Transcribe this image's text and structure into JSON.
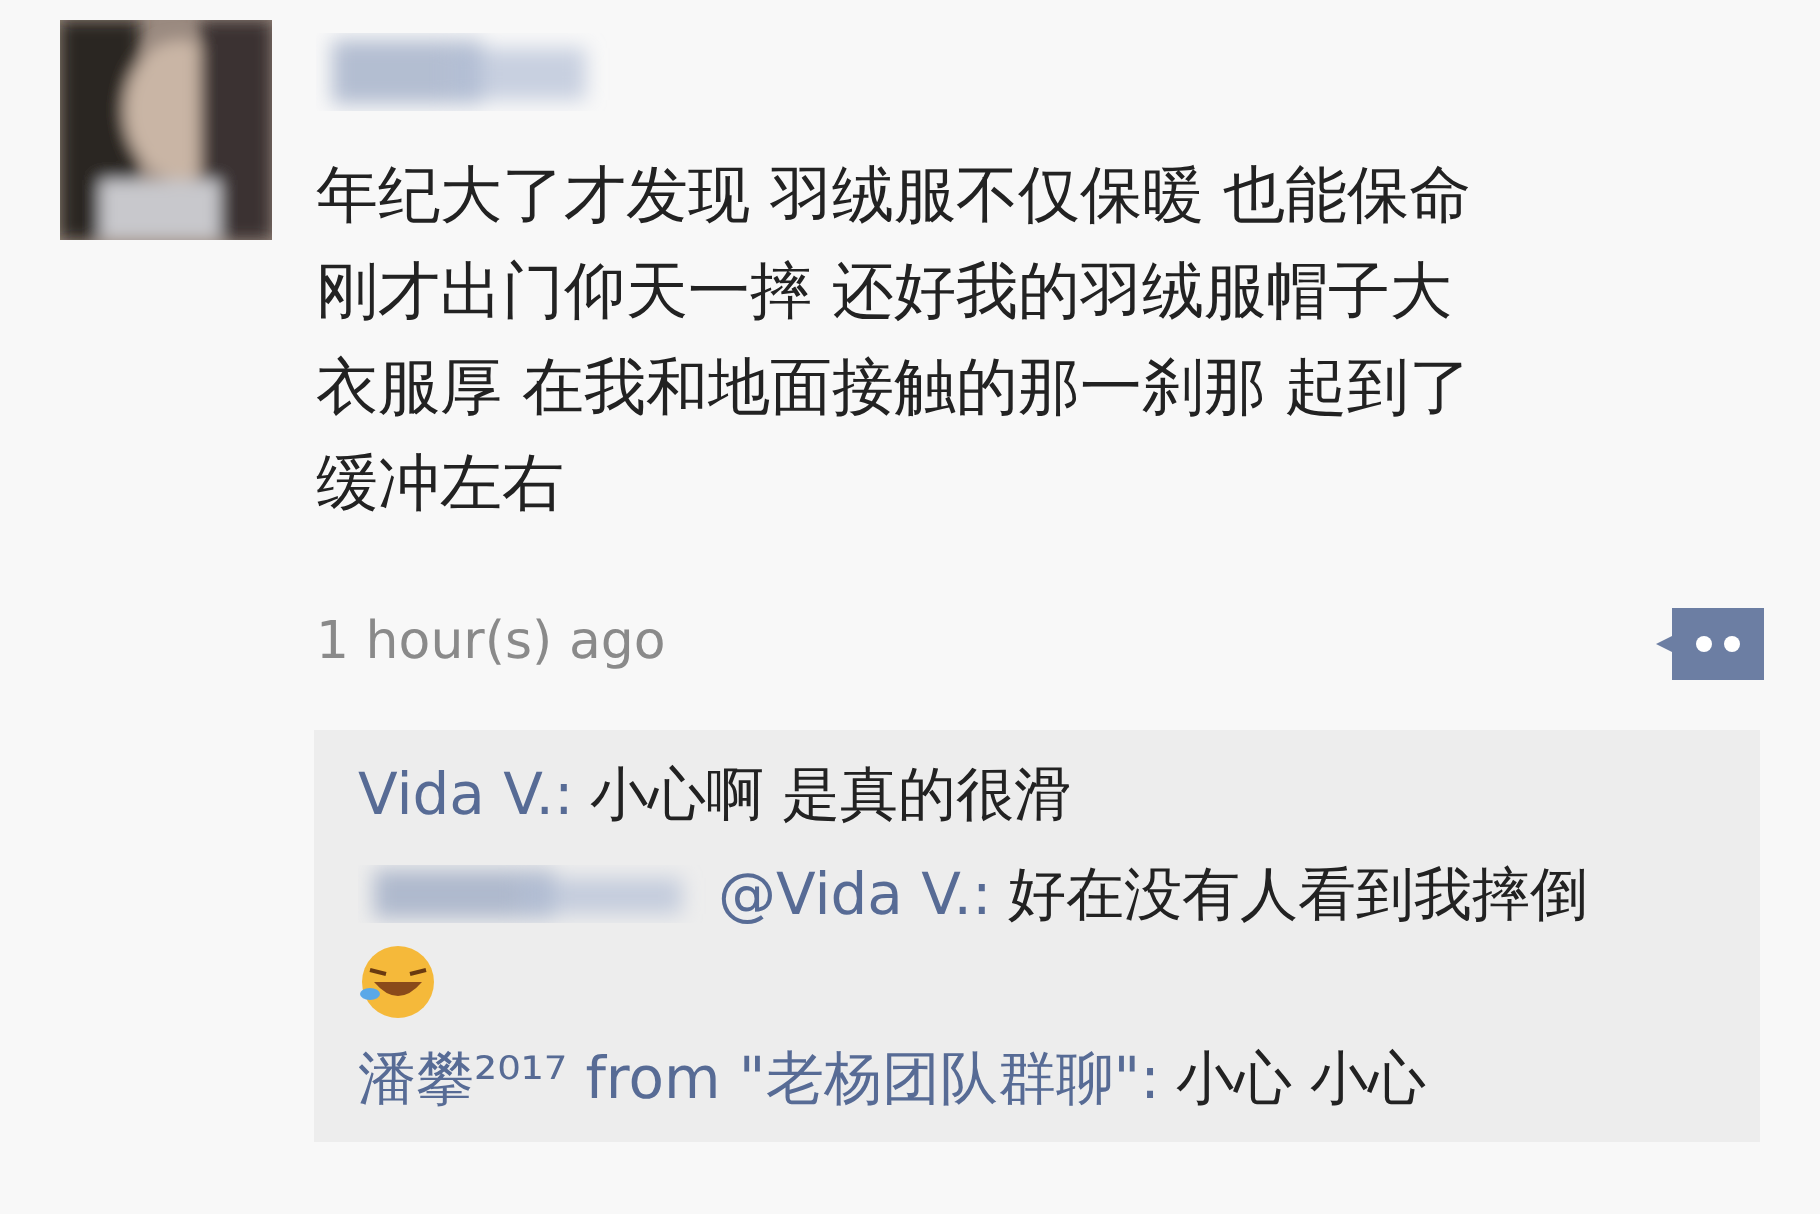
{
  "post": {
    "text_lines": [
      "年纪大了才发现 羽绒服不仅保暖 也能保命",
      "刚才出门仰天一摔 还好我的羽绒服帽子大",
      "衣服厚 在我和地面接触的那一刹那 起到了",
      "缓冲左右"
    ],
    "time": "1 hour(s) ago"
  },
  "comments": [
    {
      "author": "Vida V.:",
      "text": "小心啊 是真的很滑",
      "author_hidden": false,
      "emoji": false
    },
    {
      "author": "@Vida V.:",
      "text": "好在没有人看到我摔倒",
      "author_hidden": true,
      "emoji": true
    },
    {
      "author": "潘攀²⁰¹⁷ from \"老杨团队群聊\":",
      "text": "小心 小心",
      "author_hidden": false,
      "emoji": false
    }
  ]
}
